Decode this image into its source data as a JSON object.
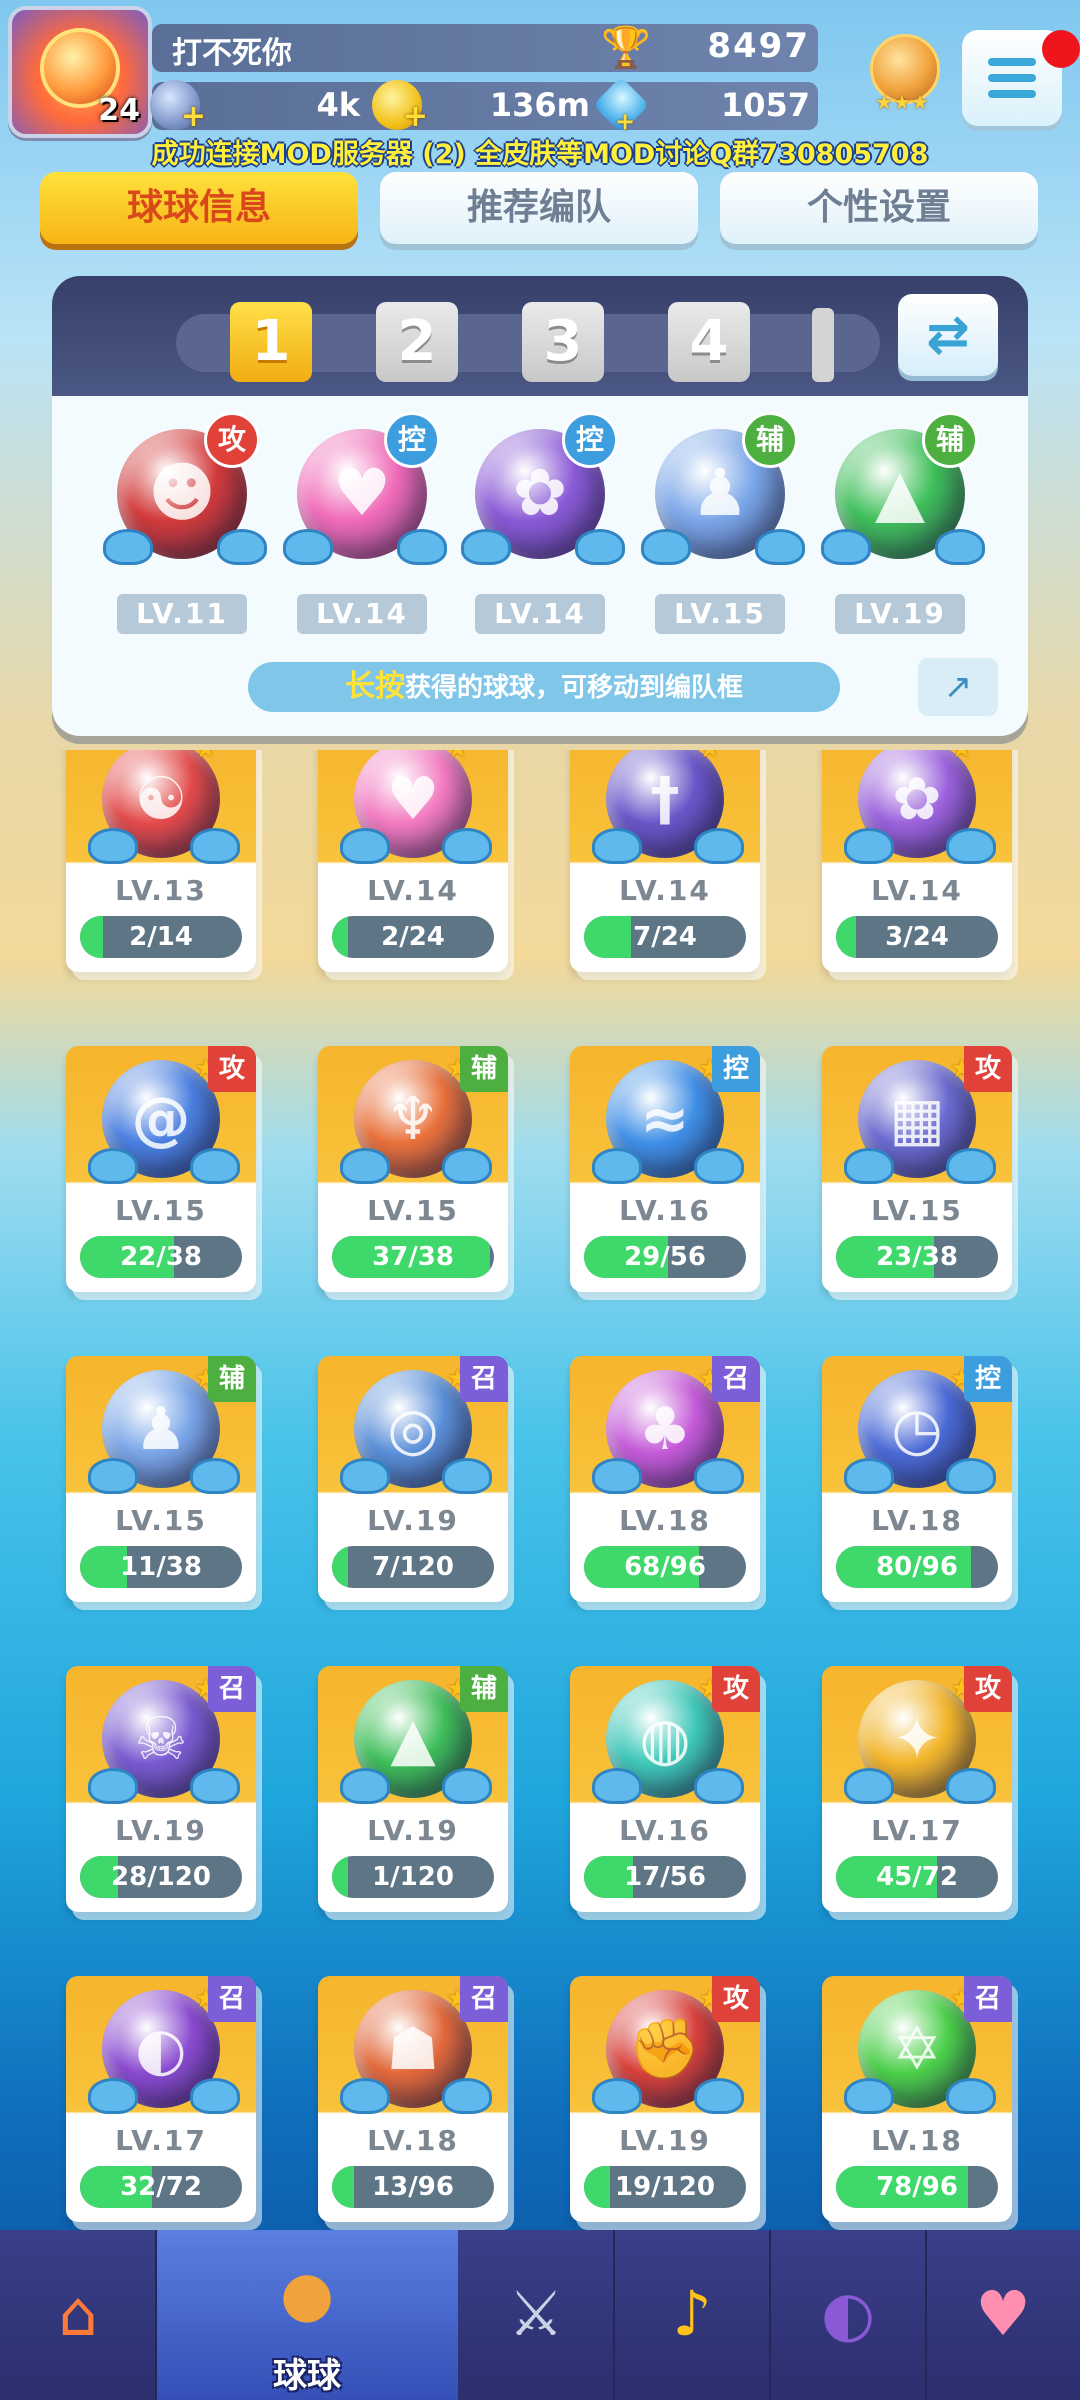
{
  "player": {
    "name": "打不死你",
    "level": "24",
    "trophies": "8497"
  },
  "resources": {
    "coins": "4k",
    "stamina": "136m",
    "gems": "1057"
  },
  "notice": "成功连接MOD服务器 (2) 全皮肤等MOD讨论Q群730805708",
  "tabs": [
    {
      "label": "球球信息",
      "active": true
    },
    {
      "label": "推荐编队",
      "active": false
    },
    {
      "label": "个性设置",
      "active": false
    }
  ],
  "team": {
    "slots": [
      "1",
      "2",
      "3",
      "4"
    ],
    "active_slot": "1",
    "balls": [
      {
        "tag": "攻",
        "type": "atk",
        "level": "LV.11",
        "color": "#d23a3a",
        "icon": "opera-mask-icon",
        "glyph": "☻"
      },
      {
        "tag": "控",
        "type": "ctl",
        "level": "LV.14",
        "color": "#f06bb8",
        "icon": "heart-icon",
        "glyph": "♥"
      },
      {
        "tag": "控",
        "type": "ctl",
        "level": "LV.14",
        "color": "#8a5ad6",
        "icon": "butterfly-icon",
        "glyph": "✿"
      },
      {
        "tag": "辅",
        "type": "sup",
        "level": "LV.15",
        "color": "#7aa6e8",
        "icon": "people-icon",
        "glyph": "♟"
      },
      {
        "tag": "辅",
        "type": "sup",
        "level": "LV.19",
        "color": "#3fbf5a",
        "icon": "tree-icon",
        "glyph": "▲"
      }
    ],
    "hint_highlight": "长按",
    "hint_text": "获得的球球，可移动到编队框"
  },
  "balls": [
    {
      "tag": "",
      "type": "atk",
      "level": "LV.13",
      "progress": "2/14",
      "fill": 0.143,
      "color": "#e34a4a",
      "icon": "yin-yang-icon",
      "glyph": "☯"
    },
    {
      "tag": "",
      "type": "ctl",
      "level": "LV.14",
      "progress": "2/24",
      "fill": 0.083,
      "color": "#f27ac0",
      "icon": "heart-icon",
      "glyph": "♥"
    },
    {
      "tag": "",
      "type": "atk",
      "level": "LV.14",
      "progress": "7/24",
      "fill": 0.292,
      "color": "#6a55c8",
      "icon": "sword-icon",
      "glyph": "†"
    },
    {
      "tag": "",
      "type": "ctl",
      "level": "LV.14",
      "progress": "3/24",
      "fill": 0.125,
      "color": "#9b62dc",
      "icon": "butterfly-icon",
      "glyph": "✿"
    },
    {
      "tag": "攻",
      "type": "atk",
      "level": "LV.15",
      "progress": "22/38",
      "fill": 0.579,
      "color": "#4a7fe0",
      "icon": "swirl-icon",
      "glyph": "@"
    },
    {
      "tag": "辅",
      "type": "sup",
      "level": "LV.15",
      "progress": "37/38",
      "fill": 0.974,
      "color": "#e8703a",
      "icon": "wings-icon",
      "glyph": "♆"
    },
    {
      "tag": "控",
      "type": "ctl",
      "level": "LV.16",
      "progress": "29/56",
      "fill": 0.518,
      "color": "#3f8fe6",
      "icon": "wave-icon",
      "glyph": "≈"
    },
    {
      "tag": "攻",
      "type": "atk",
      "level": "LV.15",
      "progress": "23/38",
      "fill": 0.605,
      "color": "#6a6ad0",
      "icon": "pixel-icon",
      "glyph": "▦"
    },
    {
      "tag": "辅",
      "type": "sup",
      "level": "LV.15",
      "progress": "11/38",
      "fill": 0.289,
      "color": "#7aa6e8",
      "icon": "people-icon",
      "glyph": "♟"
    },
    {
      "tag": "召",
      "type": "sum",
      "level": "LV.19",
      "progress": "7/120",
      "fill": 0.058,
      "color": "#5a8fd8",
      "icon": "whirlwind-icon",
      "glyph": "◎"
    },
    {
      "tag": "召",
      "type": "sum",
      "level": "LV.18",
      "progress": "68/96",
      "fill": 0.708,
      "color": "#c45ad8",
      "icon": "mushroom-icon",
      "glyph": "♣"
    },
    {
      "tag": "控",
      "type": "ctl",
      "level": "LV.18",
      "progress": "80/96",
      "fill": 0.833,
      "color": "#4a6ad6",
      "icon": "clock-icon",
      "glyph": "◷"
    },
    {
      "tag": "召",
      "type": "sum",
      "level": "LV.19",
      "progress": "28/120",
      "fill": 0.233,
      "color": "#7a5ad0",
      "icon": "ghost-icon",
      "glyph": "☠"
    },
    {
      "tag": "辅",
      "type": "sup",
      "level": "LV.19",
      "progress": "1/120",
      "fill": 0.008,
      "color": "#3fbf5a",
      "icon": "tree-icon",
      "glyph": "▲"
    },
    {
      "tag": "攻",
      "type": "atk",
      "level": "LV.16",
      "progress": "17/56",
      "fill": 0.304,
      "color": "#3ec8b8",
      "icon": "tornado-icon",
      "glyph": "◍"
    },
    {
      "tag": "攻",
      "type": "atk",
      "level": "LV.17",
      "progress": "45/72",
      "fill": 0.625,
      "color": "#f2b52a",
      "icon": "triforce-icon",
      "glyph": "✦"
    },
    {
      "tag": "召",
      "type": "sum",
      "level": "LV.17",
      "progress": "32/72",
      "fill": 0.444,
      "color": "#8a4ad0",
      "icon": "planet-icon",
      "glyph": "◐"
    },
    {
      "tag": "召",
      "type": "sum",
      "level": "LV.18",
      "progress": "13/96",
      "fill": 0.135,
      "color": "#e2683a",
      "icon": "gorilla-icon",
      "glyph": "☗"
    },
    {
      "tag": "攻",
      "type": "atk",
      "level": "LV.19",
      "progress": "19/120",
      "fill": 0.158,
      "color": "#d8403a",
      "icon": "fist-icon",
      "glyph": "✊"
    },
    {
      "tag": "召",
      "type": "sum",
      "level": "LV.18",
      "progress": "78/96",
      "fill": 0.813,
      "color": "#4ccf4a",
      "icon": "hexagram-icon",
      "glyph": "✡"
    }
  ],
  "bottom_nav": [
    {
      "label": "",
      "icon": "shop-icon",
      "glyph": "⌂",
      "active": false
    },
    {
      "label": "球球",
      "icon": "ball-icon",
      "glyph": "●",
      "active": true
    },
    {
      "label": "",
      "icon": "crossed-swords-icon",
      "glyph": "⚔",
      "active": false
    },
    {
      "label": "",
      "icon": "whistle-icon",
      "glyph": "♪",
      "active": false
    },
    {
      "label": "",
      "icon": "planet-icon",
      "glyph": "◐",
      "active": false
    },
    {
      "label": "",
      "icon": "chat-heart-icon",
      "glyph": "♥",
      "active": false
    }
  ],
  "colors": {
    "accent_yellow": "#f7b515",
    "attack": "#e0423a",
    "control": "#3c9ede",
    "support": "#4caf3f",
    "summon": "#7c5fd8",
    "progress": "#3fd86b"
  }
}
